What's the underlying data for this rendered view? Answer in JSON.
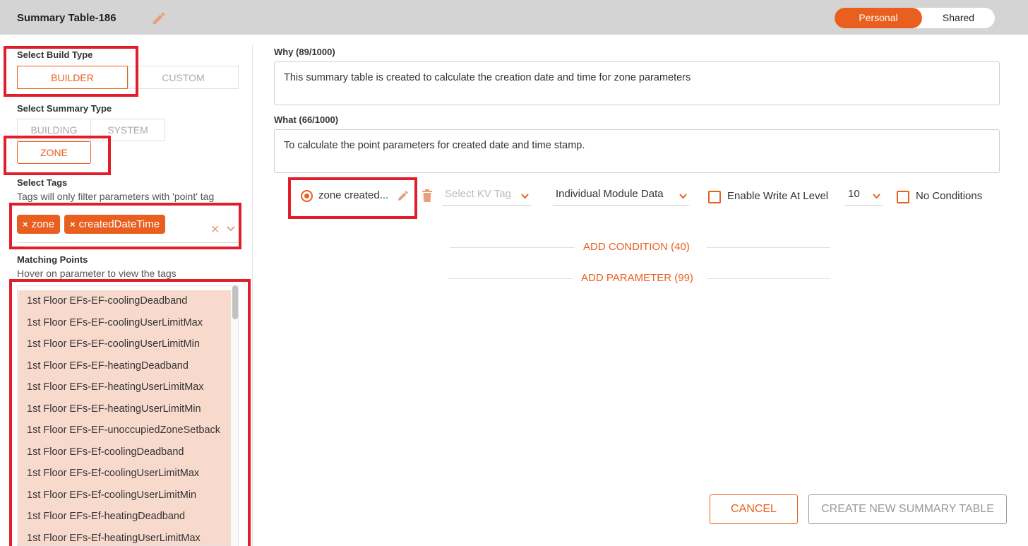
{
  "header": {
    "title": "Summary Table-186",
    "toggle": {
      "personal": "Personal",
      "shared": "Shared"
    }
  },
  "left": {
    "build_type": {
      "label": "Select Build Type",
      "options": [
        "BUILDER",
        "CUSTOM"
      ],
      "selected": "BUILDER"
    },
    "summary_type": {
      "label": "Select Summary Type",
      "options": [
        "BUILDING",
        "SYSTEM",
        "ZONE"
      ],
      "selected": "ZONE"
    },
    "tags": {
      "label": "Select Tags",
      "hint": "Tags will only filter parameters with 'point' tag",
      "chips": [
        "zone",
        "createdDateTime"
      ],
      "clear": "✕"
    },
    "matching": {
      "label": "Matching Points",
      "hint": "Hover on parameter to view the tags",
      "items": [
        "1st Floor EFs-EF-coolingDeadband",
        "1st Floor EFs-EF-coolingUserLimitMax",
        "1st Floor EFs-EF-coolingUserLimitMin",
        "1st Floor EFs-EF-heatingDeadband",
        "1st Floor EFs-EF-heatingUserLimitMax",
        "1st Floor EFs-EF-heatingUserLimitMin",
        "1st Floor EFs-EF-unoccupiedZoneSetback",
        "1st Floor EFs-Ef-coolingDeadband",
        "1st Floor EFs-Ef-coolingUserLimitMax",
        "1st Floor EFs-Ef-coolingUserLimitMin",
        "1st Floor EFs-Ef-heatingDeadband",
        "1st Floor EFs-Ef-heatingUserLimitMax"
      ]
    }
  },
  "right": {
    "why": {
      "label": "Why (89/1000)",
      "value": "This summary table is created to calculate the creation date and time for zone parameters"
    },
    "what": {
      "label": "What (66/1000)",
      "value": "To calculate the point parameters for created date and time stamp."
    },
    "parameter": {
      "name": "zone created...",
      "kv_placeholder": "Select KV Tag",
      "data_mode": "Individual Module Data",
      "enable_write_label": "Enable Write At Level",
      "level": "10",
      "no_conditions_label": "No Conditions"
    },
    "add_condition": "ADD CONDITION (40)",
    "add_parameter": "ADD PARAMETER (99)",
    "buttons": {
      "cancel": "CANCEL",
      "create": "CREATE NEW SUMMARY TABLE"
    }
  },
  "icons": [
    "pencil-icon",
    "trash-icon",
    "chevron-down-icon",
    "close-icon",
    "radio-selected-icon",
    "checkbox-icon"
  ],
  "colors": {
    "accent": "#e95f1f",
    "highlight_box": "#e21d2c",
    "list_item_bg": "#f8dacd",
    "header_bg": "#d4d4d4"
  }
}
